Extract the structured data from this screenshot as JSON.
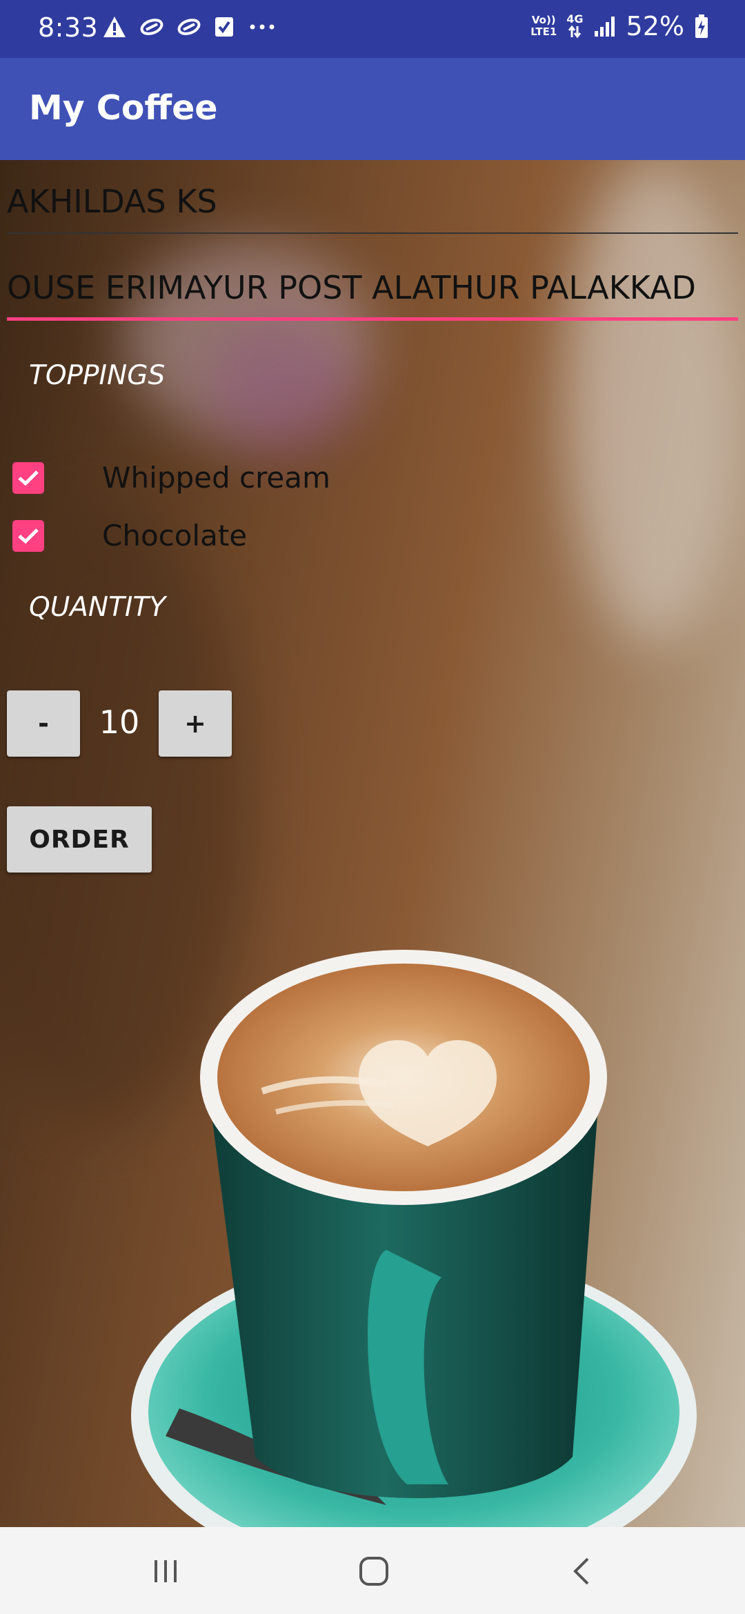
{
  "status_bar": {
    "time": "8:33",
    "network_label_top": "Vo))",
    "network_label_bottom": "LTE1",
    "network_type": "4G",
    "battery": "52%"
  },
  "app_bar": {
    "title": "My Coffee"
  },
  "form": {
    "name_value": "AKHILDAS KS",
    "address_value": "OUSE ERIMAYUR POST ALATHUR PALAKKAD",
    "toppings_label": "TOPPINGS",
    "toppings": [
      {
        "label": "Whipped cream",
        "checked": true
      },
      {
        "label": "Chocolate",
        "checked": true
      }
    ],
    "quantity_label": "QUANTITY",
    "quantity_value": "10",
    "decrement_label": "-",
    "increment_label": "+",
    "order_label": "ORDER"
  },
  "colors": {
    "status_bar": "#2f3b9e",
    "app_bar": "#3f51b5",
    "accent": "#ff4081",
    "button": "#d6d6d6"
  },
  "icons": {
    "status_left": [
      "warning-icon",
      "link-icon",
      "link-icon",
      "task-check-icon",
      "more-dots-icon"
    ],
    "status_right": [
      "data-arrows-icon",
      "signal-icon",
      "battery-charging-icon"
    ],
    "nav": [
      "recent-apps-icon",
      "home-icon",
      "back-icon"
    ]
  }
}
